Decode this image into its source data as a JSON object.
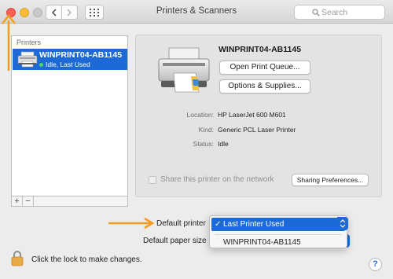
{
  "window": {
    "title": "Printers & Scanners",
    "search_placeholder": "Search"
  },
  "printers_list": {
    "header": "Printers",
    "items": [
      {
        "name": "WINPRINT04-AB1145",
        "status": "Idle, Last Used",
        "selected": true
      }
    ],
    "add_label": "+",
    "remove_label": "−"
  },
  "detail": {
    "printer_name": "WINPRINT04-AB1145",
    "open_queue_label": "Open Print Queue...",
    "options_label": "Options & Supplies...",
    "location_label": "Location:",
    "location_value": "HP LaserJet 600 M601",
    "kind_label": "Kind:",
    "kind_value": "Generic PCL Laser Printer",
    "status_label": "Status:",
    "status_value": "Idle",
    "share_label": "Share this printer on the network",
    "share_checked": false,
    "sharing_prefs_label": "Sharing Preferences..."
  },
  "defaults": {
    "default_printer_label": "Default printer",
    "default_paper_label": "Default paper size",
    "menu_selected_check": "✓",
    "menu_selected": "Last Printer Used",
    "menu_items": [
      "WINPRINT04-AB1145"
    ]
  },
  "footer": {
    "lock_text": "Click the lock to make changes.",
    "help_label": "?"
  },
  "colors": {
    "accent": "#1d69d5",
    "annotation": "#f39a22",
    "status_dot": "#4dd55c"
  }
}
